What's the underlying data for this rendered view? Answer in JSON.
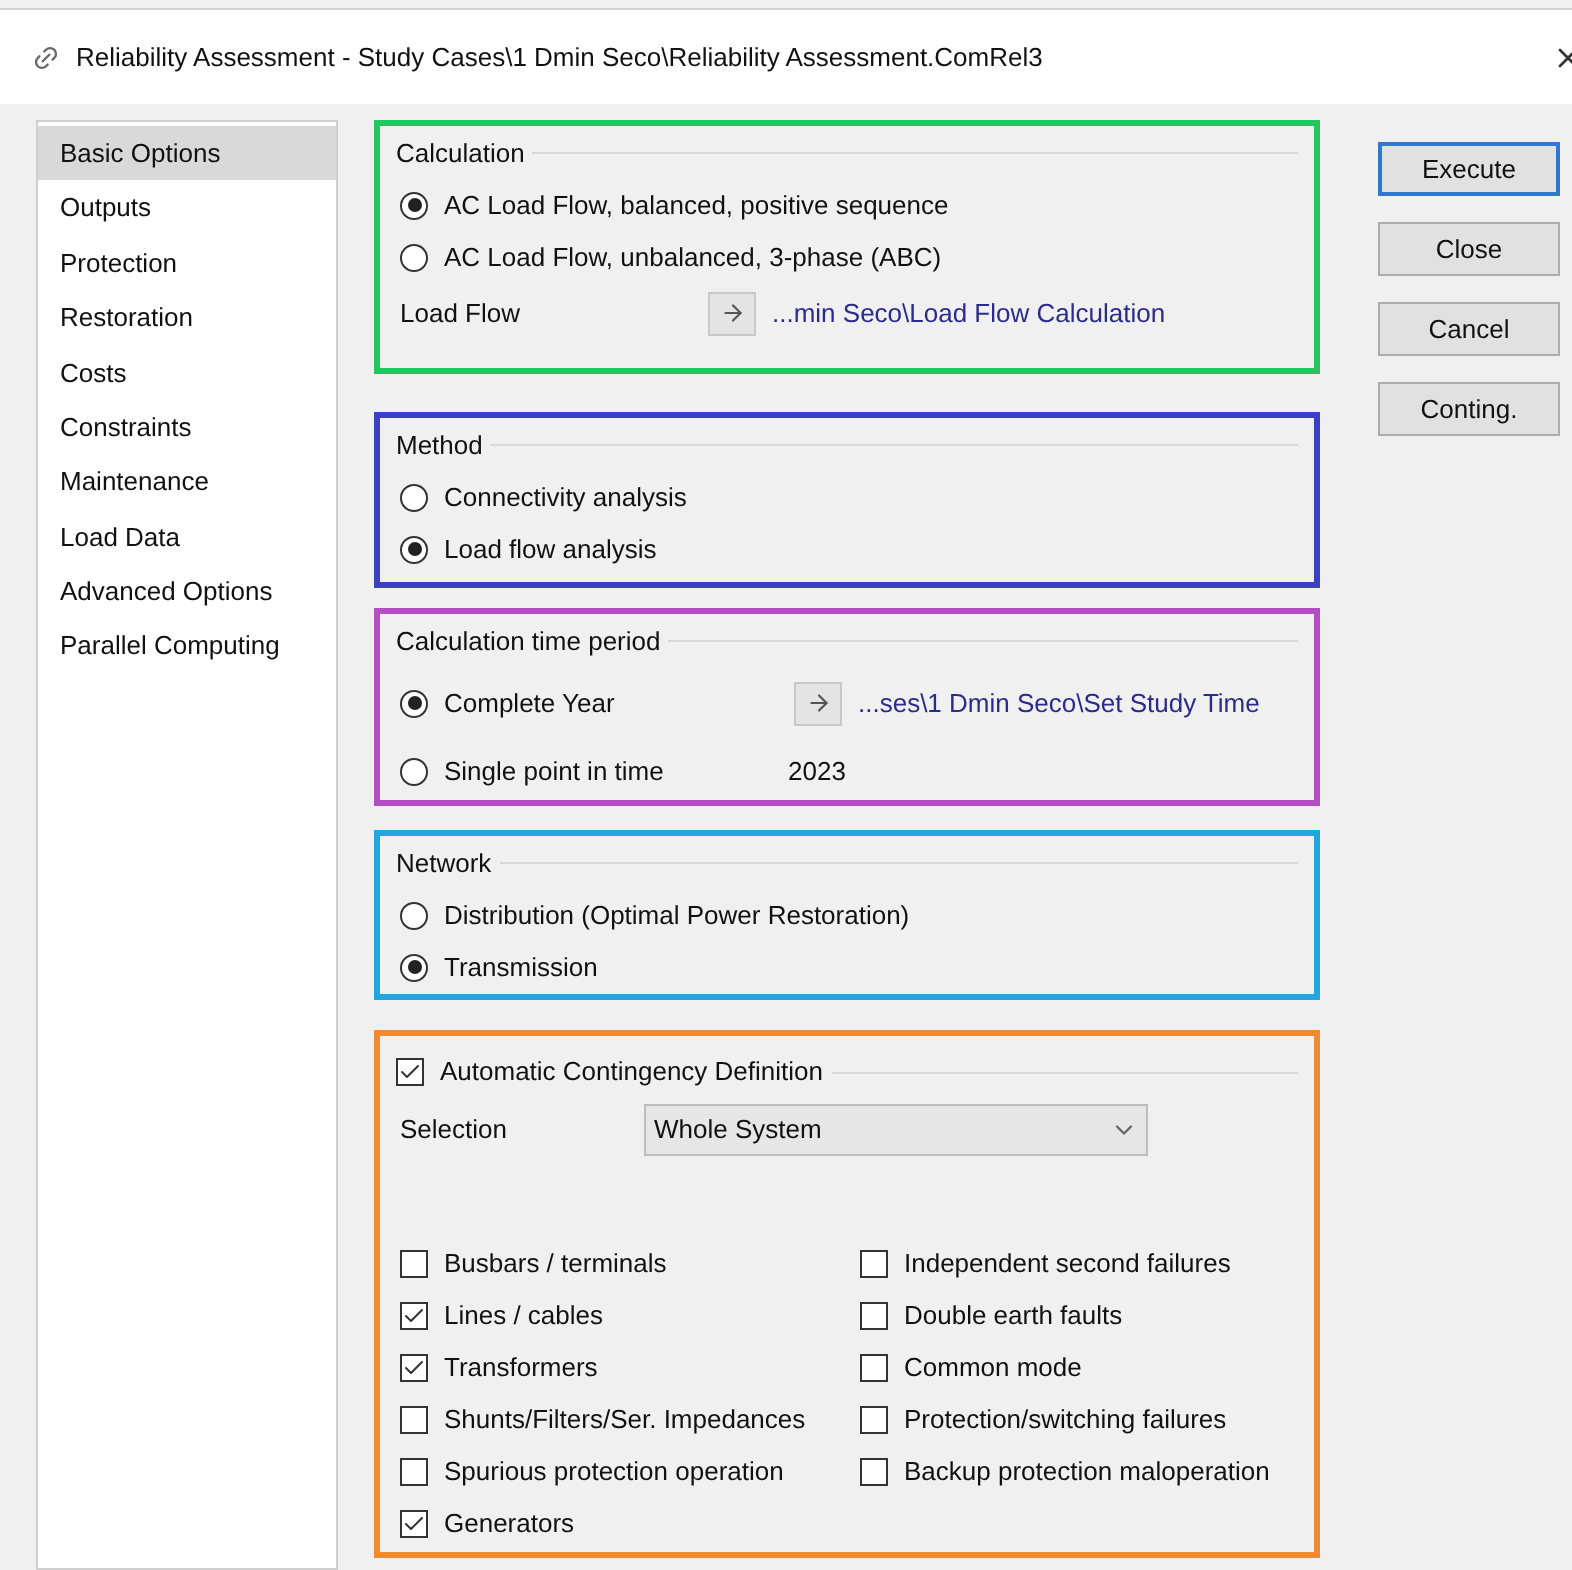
{
  "window": {
    "title": "Reliability Assessment - Study Cases\\1 Dmin Seco\\Reliability Assessment.ComRel3"
  },
  "sidebar": {
    "items": [
      {
        "label": "Basic Options",
        "selected": true
      },
      {
        "label": "Outputs",
        "selected": false
      },
      {
        "label": "Protection",
        "selected": false
      },
      {
        "label": "Restoration",
        "selected": false
      },
      {
        "label": "Costs",
        "selected": false
      },
      {
        "label": "Constraints",
        "selected": false
      },
      {
        "label": "Maintenance",
        "selected": false
      },
      {
        "label": "Load Data",
        "selected": false
      },
      {
        "label": "Advanced Options",
        "selected": false
      },
      {
        "label": "Parallel Computing",
        "selected": false
      }
    ]
  },
  "calculation": {
    "title": "Calculation",
    "color": "#22c55e",
    "options": [
      {
        "label": "AC Load Flow, balanced, positive sequence",
        "selected": true
      },
      {
        "label": "AC Load Flow, unbalanced, 3-phase (ABC)",
        "selected": false
      }
    ],
    "load_flow": {
      "label": "Load Flow",
      "link": "...min Seco\\Load Flow Calculation"
    }
  },
  "method": {
    "title": "Method",
    "color": "#3b3fc4",
    "options": [
      {
        "label": "Connectivity analysis",
        "selected": false
      },
      {
        "label": "Load flow analysis",
        "selected": true
      }
    ]
  },
  "time_period": {
    "title": "Calculation time period",
    "color": "#b44cc4",
    "options": [
      {
        "label": "Complete Year",
        "selected": true,
        "link": "...ses\\1 Dmin Seco\\Set Study Time"
      },
      {
        "label": "Single point in time",
        "selected": false,
        "value": "2023"
      }
    ]
  },
  "network": {
    "title": "Network",
    "color": "#1ea7e1",
    "options": [
      {
        "label": "Distribution (Optimal Power Restoration)",
        "selected": false
      },
      {
        "label": "Transmission",
        "selected": true
      }
    ]
  },
  "contingency": {
    "label": "Automatic Contingency Definition",
    "checked": true,
    "color": "#f08a30",
    "selection": {
      "label": "Selection",
      "value": "Whole System"
    },
    "left": [
      {
        "label": "Busbars / terminals",
        "checked": false
      },
      {
        "label": "Lines / cables",
        "checked": true
      },
      {
        "label": "Transformers",
        "checked": true
      },
      {
        "label": "Shunts/Filters/Ser. Impedances",
        "checked": false
      },
      {
        "label": "Spurious protection operation",
        "checked": false
      },
      {
        "label": "Generators",
        "checked": true
      }
    ],
    "right": [
      {
        "label": "Independent second failures",
        "checked": false
      },
      {
        "label": "Double earth faults",
        "checked": false
      },
      {
        "label": "Common mode",
        "checked": false
      },
      {
        "label": "Protection/switching failures",
        "checked": false
      },
      {
        "label": "Backup protection maloperation",
        "checked": false
      }
    ]
  },
  "buttons": [
    {
      "label": "Execute",
      "default": true
    },
    {
      "label": "Close",
      "default": false
    },
    {
      "label": "Cancel",
      "default": false
    },
    {
      "label": "Conting.",
      "default": false
    }
  ]
}
